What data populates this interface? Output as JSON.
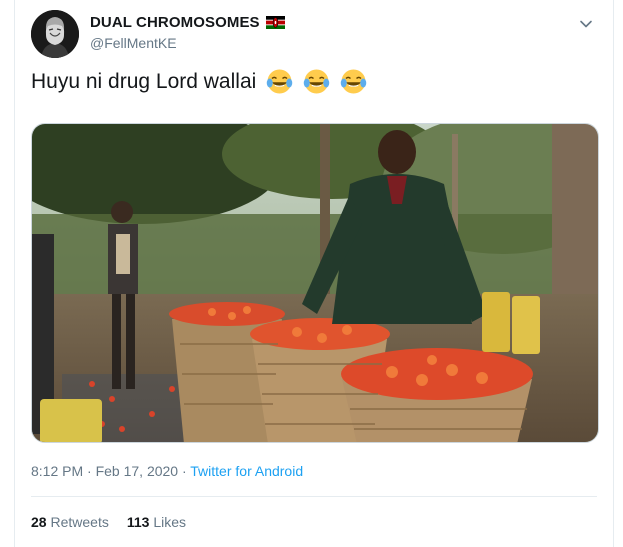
{
  "tweet": {
    "display_name": "DUAL CHROMOSOMES",
    "handle": "@FellMentKE",
    "text": "Huyu ni drug Lord wallai",
    "emoji": [
      "face-with-tears-of-joy",
      "face-with-tears-of-joy",
      "face-with-tears-of-joy"
    ],
    "timestamp": "8:12 PM · Feb 17, 2020 · ",
    "source": "Twitter for Android",
    "retweets_count": "28",
    "retweets_label": "Retweets",
    "likes_count": "113",
    "likes_label": "Likes"
  },
  "colors": {
    "text_primary": "#14171a",
    "text_secondary": "#657786",
    "link": "#1da1f2",
    "border": "#e6ecf0"
  },
  "icons": {
    "caret": "chevron-down-icon",
    "flag": "kenya-flag-icon"
  }
}
